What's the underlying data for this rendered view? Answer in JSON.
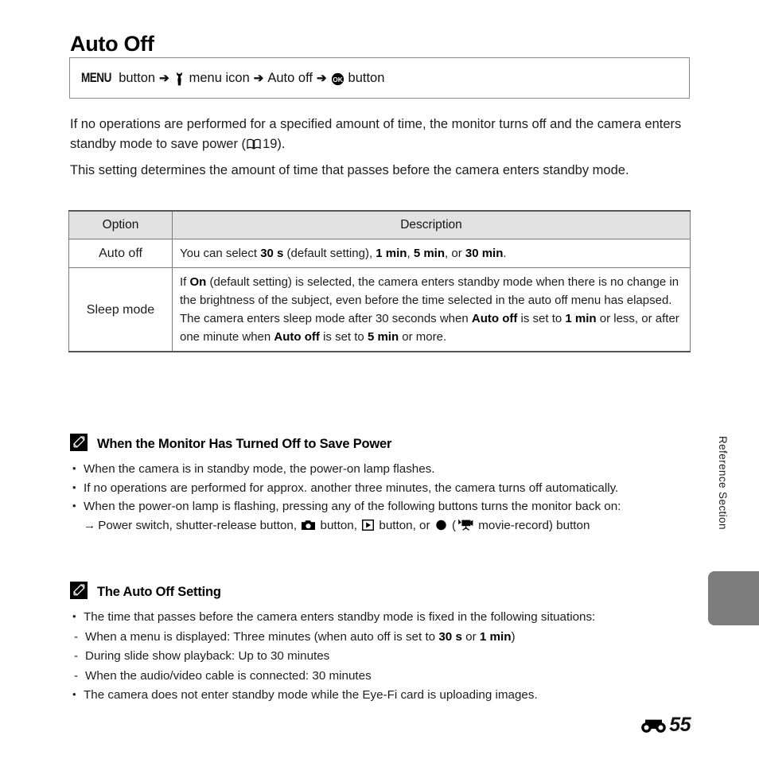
{
  "page": {
    "title": "Auto Off",
    "side_label": "Reference Section",
    "page_number": "55",
    "page_prefix_icon": "reference-section-e-icon"
  },
  "breadcrumb": {
    "menu_label": "MENU",
    "menu_button_word": "button",
    "arrow": "➔",
    "setup_icon": "wrench-menu-icon",
    "setup_label": "menu icon",
    "item_label": "Auto off",
    "ok_icon": "ok-button-icon",
    "ok_button_word": "button"
  },
  "intro": {
    "paragraph1_a": "If no operations are performed for a specified amount of time, the monitor turns off and the camera enters standby mode to save power (",
    "paragraph1_ref": "19",
    "paragraph1_b": ").",
    "paragraph2": "This setting determines the amount of time that passes before the camera enters standby mode."
  },
  "table": {
    "headers": [
      "Option",
      "Description"
    ],
    "rows": [
      {
        "option": "Auto off",
        "desc_parts": [
          {
            "t": "You can select ",
            "b": false
          },
          {
            "t": "30 s",
            "b": true
          },
          {
            "t": " (default setting), ",
            "b": false
          },
          {
            "t": "1 min",
            "b": true
          },
          {
            "t": ", ",
            "b": false
          },
          {
            "t": "5 min",
            "b": true
          },
          {
            "t": ", or ",
            "b": false
          },
          {
            "t": "30 min",
            "b": true
          },
          {
            "t": ".",
            "b": false
          }
        ]
      },
      {
        "option": "Sleep mode",
        "desc_parts": [
          {
            "t": "If ",
            "b": false
          },
          {
            "t": "On",
            "b": true
          },
          {
            "t": " (default setting) is selected, the camera enters standby mode when there is no change in the brightness of the subject, even before the time selected in the auto off menu has elapsed. The camera enters sleep mode after 30 seconds when ",
            "b": false
          },
          {
            "t": "Auto off",
            "b": true
          },
          {
            "t": " is set to ",
            "b": false
          },
          {
            "t": "1 min",
            "b": true
          },
          {
            "t": " or less, or after one minute when ",
            "b": false
          },
          {
            "t": "Auto off",
            "b": true
          },
          {
            "t": " is set to ",
            "b": false
          },
          {
            "t": "5 min",
            "b": true
          },
          {
            "t": " or more.",
            "b": false
          }
        ]
      }
    ]
  },
  "note1": {
    "icon": "pencil-note-icon",
    "title": "When the Monitor Has Turned Off to Save Power",
    "bullets": [
      "When the camera is in standby mode, the power-on lamp flashes.",
      "If no operations are performed for approx. another three minutes, the camera turns off automatically.",
      "When the power-on lamp is flashing, pressing any of the following buttons turns the monitor back on:"
    ],
    "sub_line": {
      "arrow": "→",
      "text_a": "Power switch, shutter-release button, ",
      "camera_icon": "camera-shooting-mode-icon",
      "text_b": " button, ",
      "playback_icon": "playback-mode-icon",
      "text_c": " button, or ",
      "record_icon": "record-dot-icon",
      "text_d": " (",
      "movie_icon": "movie-record-icon",
      "text_e": " movie-record) button"
    }
  },
  "note2": {
    "icon": "pencil-note-icon",
    "title": "The Auto Off Setting",
    "bullet1": "The time that passes before the camera enters standby mode is fixed in the following situations:",
    "sub_items": [
      [
        {
          "t": "When a menu is displayed: Three minutes (when auto off is set to ",
          "b": false
        },
        {
          "t": "30 s",
          "b": true
        },
        {
          "t": " or ",
          "b": false
        },
        {
          "t": "1 min",
          "b": true
        },
        {
          "t": ")",
          "b": false
        }
      ],
      [
        {
          "t": "During slide show playback: Up to 30 minutes",
          "b": false
        }
      ],
      [
        {
          "t": "When the audio/video cable is connected: 30 minutes",
          "b": false
        }
      ]
    ],
    "bullet2": "The camera does not enter standby mode while the Eye-Fi card is uploading images."
  },
  "colors": {
    "table_header_bg": "#e2e2e2",
    "border": "#7a7a7a",
    "side_tab": "#7d7d7d",
    "text": "#1c1c1c"
  }
}
